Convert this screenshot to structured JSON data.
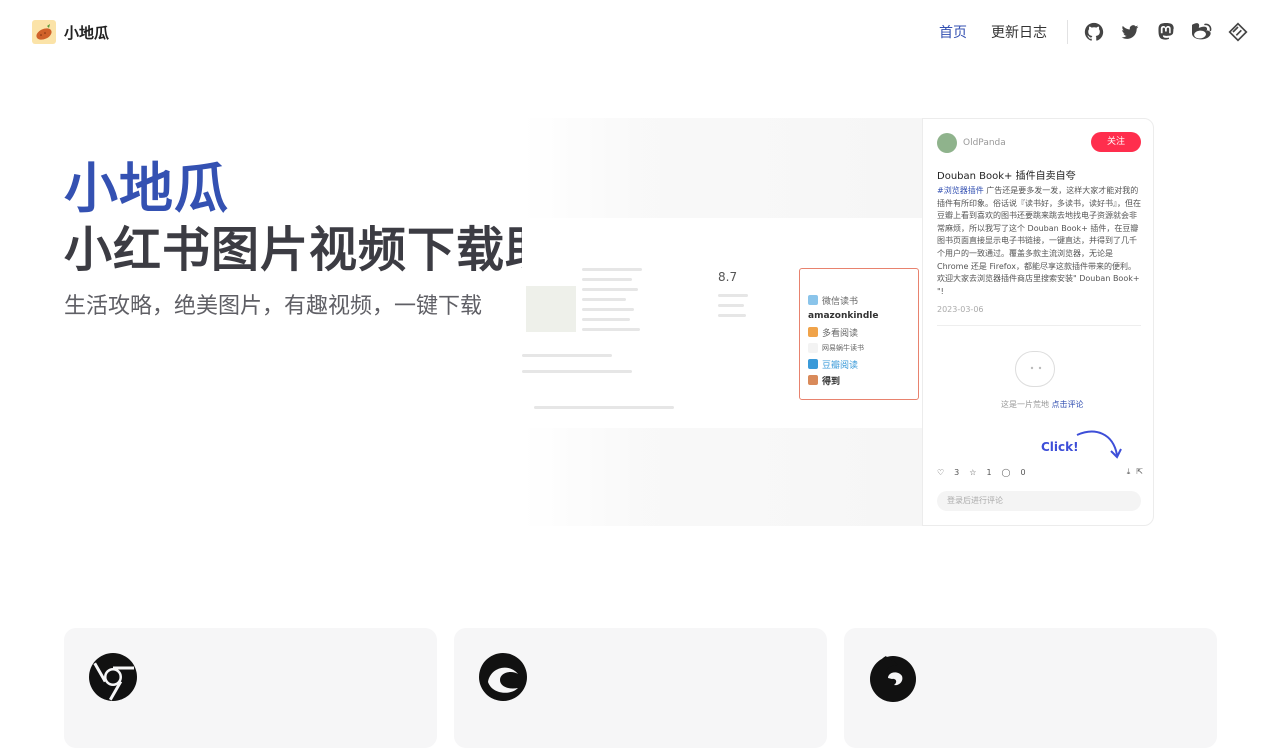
{
  "nav": {
    "brand": "小地瓜",
    "links": [
      {
        "label": "首页",
        "active": true
      },
      {
        "label": "更新日志",
        "active": false
      }
    ],
    "social_icons": [
      "github-icon",
      "twitter-icon",
      "mastodon-icon",
      "weibo-icon",
      "sketch-icon"
    ]
  },
  "hero": {
    "title": "小地瓜",
    "tagline": "小红书图片视频下载助手",
    "description": "生活攻略，绝美图片，有趣视频，一键下载"
  },
  "screenshot": {
    "rating": "8.7",
    "popup_items": [
      "微信读书",
      "amazonkindle",
      "多看阅读",
      "网易蜗牛读书",
      "豆瓣阅读",
      "得到"
    ],
    "post": {
      "user": "OldPanda",
      "follow": "关注",
      "title": "Douban Book+ 插件自卖自夸",
      "tag": "#浏览器插件",
      "body": "广告还是要多发一发，这样大家才能对我的插件有所印象。俗话说『读书好，多读书，读好书』，但在豆瓣上看到喜欢的图书还要跳来跳去地找电子资源就会非常麻烦，所以我写了这个 Douban Book+ 插件，在豆瓣图书页面直接显示电子书链接，一键直达，并得到了几千个用户的一致通过。覆盖多款主流浏览器，无论是 Chrome 还是 Firefox，都能尽享这款插件带来的便利。欢迎大家去浏览器插件商店里搜索安装\" Douban Book+ \"!",
      "date": "2023-03-06",
      "empty": "这是一片荒地",
      "empty_link": "点击评论",
      "click_label": "Click!",
      "likes": "3",
      "stars": "1",
      "comments": "0",
      "comment_placeholder": "登录后进行评论"
    }
  },
  "cards": [
    {
      "icon": "chrome-icon"
    },
    {
      "icon": "edge-icon"
    },
    {
      "icon": "firefox-icon"
    }
  ],
  "colors": {
    "brand": "#3451b2",
    "follow": "#ff2e4d",
    "popup_border": "#e8826e"
  }
}
